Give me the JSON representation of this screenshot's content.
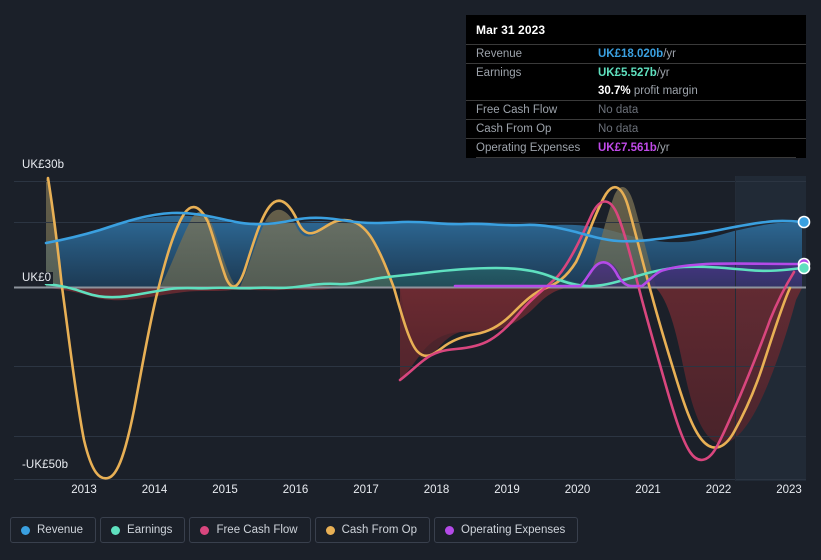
{
  "chart_data": {
    "type": "area",
    "title": "",
    "xlabel": "",
    "ylabel": "",
    "currency": "UK£",
    "grid": true,
    "legend_position": "bottom",
    "x": [
      2012.5,
      2013,
      2014,
      2015,
      2016,
      2017,
      2018,
      2019,
      2020,
      2021,
      2022,
      2023
    ],
    "axis": {
      "y_ticks": [
        {
          "label": "UK£30b",
          "value": 30
        },
        {
          "label": "UK£0",
          "value": 0
        },
        {
          "label": "-UK£50b",
          "value": -50
        }
      ],
      "ylim": [
        -55,
        34
      ],
      "x_ticks": [
        "2013",
        "2014",
        "2015",
        "2016",
        "2017",
        "2018",
        "2019",
        "2020",
        "2021",
        "2022",
        "2023"
      ]
    },
    "series": [
      {
        "name": "Revenue",
        "color": "#3aa0e0",
        "fill": "#1b4f73",
        "values": [
          13.0,
          13.5,
          16.2,
          17.3,
          16.4,
          17.0,
          16.8,
          17.4,
          17.2,
          17.4,
          14.6,
          15.6,
          18.02
        ],
        "end_value": 18.02
      },
      {
        "name": "Earnings",
        "color": "#5fe0bf",
        "fill": "#1d5f58",
        "values": [
          0.6,
          -0.8,
          -1.6,
          -0.6,
          -0.2,
          0.1,
          0.5,
          2.4,
          3.6,
          0.4,
          2.6,
          4.4,
          5.527
        ],
        "end_value": 5.527
      },
      {
        "name": "Free Cash Flow",
        "color": "#d9467e",
        "fill": "#5e2030",
        "values": [
          null,
          null,
          null,
          null,
          null,
          -14.5,
          -21.6,
          -17.2,
          -16.2,
          6.5,
          -38.0,
          -18.0,
          -2.0
        ],
        "start_year": 2017.6,
        "end_value": null
      },
      {
        "name": "Cash From Op",
        "color": "#e8b055",
        "fill": "#6b5c3a",
        "values": [
          31.0,
          -50.5,
          15.0,
          13.0,
          12.5,
          -24.0,
          -18.2,
          -13.0,
          -12.4,
          24.5,
          -34.8,
          -14.0,
          0.5
        ],
        "end_value": null
      },
      {
        "name": "Operating Expenses",
        "color": "#b44ae8",
        "fill": "#3a2a6b",
        "values": [
          null,
          null,
          null,
          null,
          null,
          0.2,
          0.2,
          0.2,
          0.2,
          5.4,
          6.2,
          7.4,
          7.561
        ],
        "start_year": 2018.3,
        "end_value": 7.561
      }
    ]
  },
  "tooltip": {
    "title": "Mar 31 2023",
    "rows": [
      {
        "label": "Revenue",
        "amount": "UK£18.020b",
        "unit": "/yr",
        "color": "#3aa0e0",
        "no_data": false
      },
      {
        "label": "Earnings",
        "amount": "UK£5.527b",
        "unit": "/yr",
        "color": "#5fe0bf",
        "no_data": false
      }
    ],
    "margin": {
      "value": "30.7%",
      "text": "profit margin"
    },
    "rows2": [
      {
        "label": "Free Cash Flow",
        "amount": "No data",
        "unit": "",
        "color": "#6b7079",
        "no_data": true
      },
      {
        "label": "Cash From Op",
        "amount": "No data",
        "unit": "",
        "color": "#6b7079",
        "no_data": true
      },
      {
        "label": "Operating Expenses",
        "amount": "UK£7.561b",
        "unit": "/yr",
        "color": "#c04ae8",
        "no_data": false
      }
    ]
  },
  "legend": {
    "items": [
      {
        "label": "Revenue",
        "color": "#3aa0e0"
      },
      {
        "label": "Earnings",
        "color": "#5fe0bf"
      },
      {
        "label": "Free Cash Flow",
        "color": "#d9467e"
      },
      {
        "label": "Cash From Op",
        "color": "#e8b055"
      },
      {
        "label": "Operating Expenses",
        "color": "#b44ae8"
      }
    ]
  },
  "colors": {
    "background": "#1b2029",
    "grid": "#2b3340",
    "zero_line": "#8d939c",
    "forecast_band": "#1f2731"
  }
}
